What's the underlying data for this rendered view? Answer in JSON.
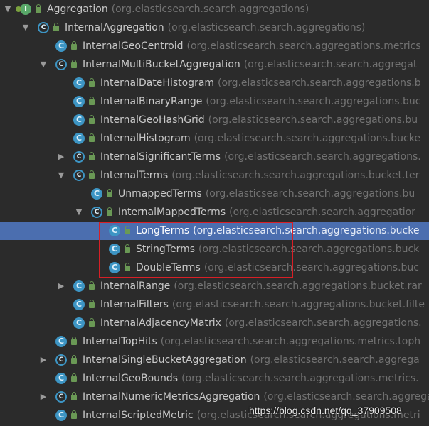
{
  "tree": {
    "nodes": [
      {
        "name": "Aggregation",
        "package": "(org.elasticsearch.search.aggregations)",
        "arrow": "▼",
        "icon": "interface",
        "badge": "I",
        "depth": 0
      },
      {
        "name": "InternalAggregation",
        "package": "(org.elasticsearch.search.aggregations)",
        "arrow": "▼",
        "icon": "abstract",
        "badge": "C",
        "depth": 1
      },
      {
        "name": "InternalGeoCentroid",
        "package": "(org.elasticsearch.search.aggregations.metrics",
        "arrow": "",
        "icon": "class",
        "badge": "C",
        "depth": 2
      },
      {
        "name": "InternalMultiBucketAggregation",
        "package": "(org.elasticsearch.search.aggregat",
        "arrow": "▼",
        "icon": "abstract",
        "badge": "C",
        "depth": 2
      },
      {
        "name": "InternalDateHistogram",
        "package": "(org.elasticsearch.search.aggregations.b",
        "arrow": "",
        "icon": "class",
        "badge": "C",
        "depth": 3
      },
      {
        "name": "InternalBinaryRange",
        "package": "(org.elasticsearch.search.aggregations.buc",
        "arrow": "",
        "icon": "class",
        "badge": "C",
        "depth": 3
      },
      {
        "name": "InternalGeoHashGrid",
        "package": "(org.elasticsearch.search.aggregations.bu",
        "arrow": "",
        "icon": "class",
        "badge": "C",
        "depth": 3
      },
      {
        "name": "InternalHistogram",
        "package": "(org.elasticsearch.search.aggregations.bucke",
        "arrow": "",
        "icon": "class",
        "badge": "C",
        "depth": 3
      },
      {
        "name": "InternalSignificantTerms",
        "package": "(org.elasticsearch.search.aggregations.",
        "arrow": "▶",
        "icon": "abstract",
        "badge": "C",
        "depth": 3
      },
      {
        "name": "InternalTerms",
        "package": "(org.elasticsearch.search.aggregations.bucket.ter",
        "arrow": "▼",
        "icon": "abstract",
        "badge": "C",
        "depth": 3
      },
      {
        "name": "UnmappedTerms",
        "package": "(org.elasticsearch.search.aggregations.bu",
        "arrow": "",
        "icon": "class",
        "badge": "C",
        "depth": 4
      },
      {
        "name": "InternalMappedTerms",
        "package": "(org.elasticsearch.search.aggregatior",
        "arrow": "▼",
        "icon": "abstract",
        "badge": "C",
        "depth": 4
      },
      {
        "name": "LongTerms",
        "package": "(org.elasticsearch.search.aggregations.bucke",
        "arrow": "",
        "icon": "class",
        "badge": "C",
        "depth": 5,
        "selected": true
      },
      {
        "name": "StringTerms",
        "package": "(org.elasticsearch.search.aggregations.buck",
        "arrow": "",
        "icon": "class",
        "badge": "C",
        "depth": 5
      },
      {
        "name": "DoubleTerms",
        "package": "(org.elasticsearch.search.aggregations.buc",
        "arrow": "",
        "icon": "class",
        "badge": "C",
        "depth": 5
      },
      {
        "name": "InternalRange",
        "package": "(org.elasticsearch.search.aggregations.bucket.rar",
        "arrow": "▶",
        "icon": "class",
        "badge": "C",
        "depth": 3
      },
      {
        "name": "InternalFilters",
        "package": "(org.elasticsearch.search.aggregations.bucket.filte",
        "arrow": "",
        "icon": "class",
        "badge": "C",
        "depth": 3
      },
      {
        "name": "InternalAdjacencyMatrix",
        "package": "(org.elasticsearch.search.aggregations.",
        "arrow": "",
        "icon": "class",
        "badge": "C",
        "depth": 3
      },
      {
        "name": "InternalTopHits",
        "package": "(org.elasticsearch.search.aggregations.metrics.toph",
        "arrow": "",
        "icon": "class",
        "badge": "C",
        "depth": 2
      },
      {
        "name": "InternalSingleBucketAggregation",
        "package": "(org.elasticsearch.search.aggrega",
        "arrow": "▶",
        "icon": "abstract",
        "badge": "C",
        "depth": 2
      },
      {
        "name": "InternalGeoBounds",
        "package": "(org.elasticsearch.search.aggregations.metrics.",
        "arrow": "",
        "icon": "class",
        "badge": "C",
        "depth": 2
      },
      {
        "name": "InternalNumericMetricsAggregation",
        "package": "(org.elasticsearch.search.aggrega",
        "arrow": "▶",
        "icon": "abstract",
        "badge": "C",
        "depth": 2
      },
      {
        "name": "InternalScriptedMetric",
        "package": "(org.elasticsearch.search.aggregations.metri",
        "arrow": "",
        "icon": "class",
        "badge": "C",
        "depth": 2
      }
    ]
  },
  "watermark": "https://blog.csdn.net/qq_37909508",
  "colors": {
    "background": "#2b2b2b",
    "selection": "#4b6eaf",
    "highlight_border": "#d81f26",
    "class_icon": "#3d95c4",
    "interface_icon": "#59a869"
  }
}
